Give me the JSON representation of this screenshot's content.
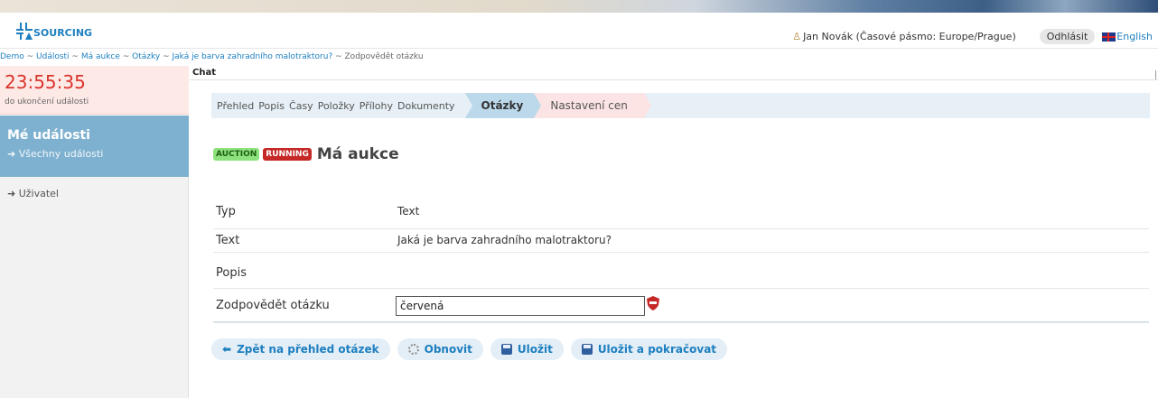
{
  "header": {
    "logo_text": "SOURCING",
    "user": "Jan Novák (Časové pásmo: Europe/Prague)",
    "logout": "Odhlásit",
    "language": "English"
  },
  "breadcrumb": {
    "items": [
      "Demo",
      "Události",
      "Má aukce",
      "Otázky",
      "Jaká je barva zahradního malotraktoru?"
    ],
    "current": "Zodpovědět otázku"
  },
  "sidebar": {
    "timer": "23:55:35",
    "timer_label": "do ukončení události",
    "events_title": "Mé události",
    "events_link": "➜ Všechny události",
    "user_link": "➜ Uživatel"
  },
  "chat_label": "Chat",
  "tabs": [
    "Přehled",
    "Popis",
    "Časy",
    "Položky",
    "Přílohy",
    "Dokumenty"
  ],
  "active_tab": "Otázky",
  "next_tab": "Nastavení cen",
  "event": {
    "badge_type": "AUCTION",
    "badge_status": "RUNNING",
    "title": "Má aukce"
  },
  "fields": {
    "typ_label": "Typ",
    "typ_value": "Text",
    "text_label": "Text",
    "text_value": "Jaká je barva zahradního malotraktoru?",
    "popis_label": "Popis",
    "answer_label": "Zodpovědět otázku",
    "answer_value": "červená"
  },
  "actions": {
    "back": "Zpět na přehled otázek",
    "refresh": "Obnovit",
    "save": "Uložit",
    "save_continue": "Uložit a pokračovat"
  },
  "colors": {
    "accent": "#1d7fc0",
    "timer": "#d9342b",
    "events_bg": "#7eb1cf"
  }
}
